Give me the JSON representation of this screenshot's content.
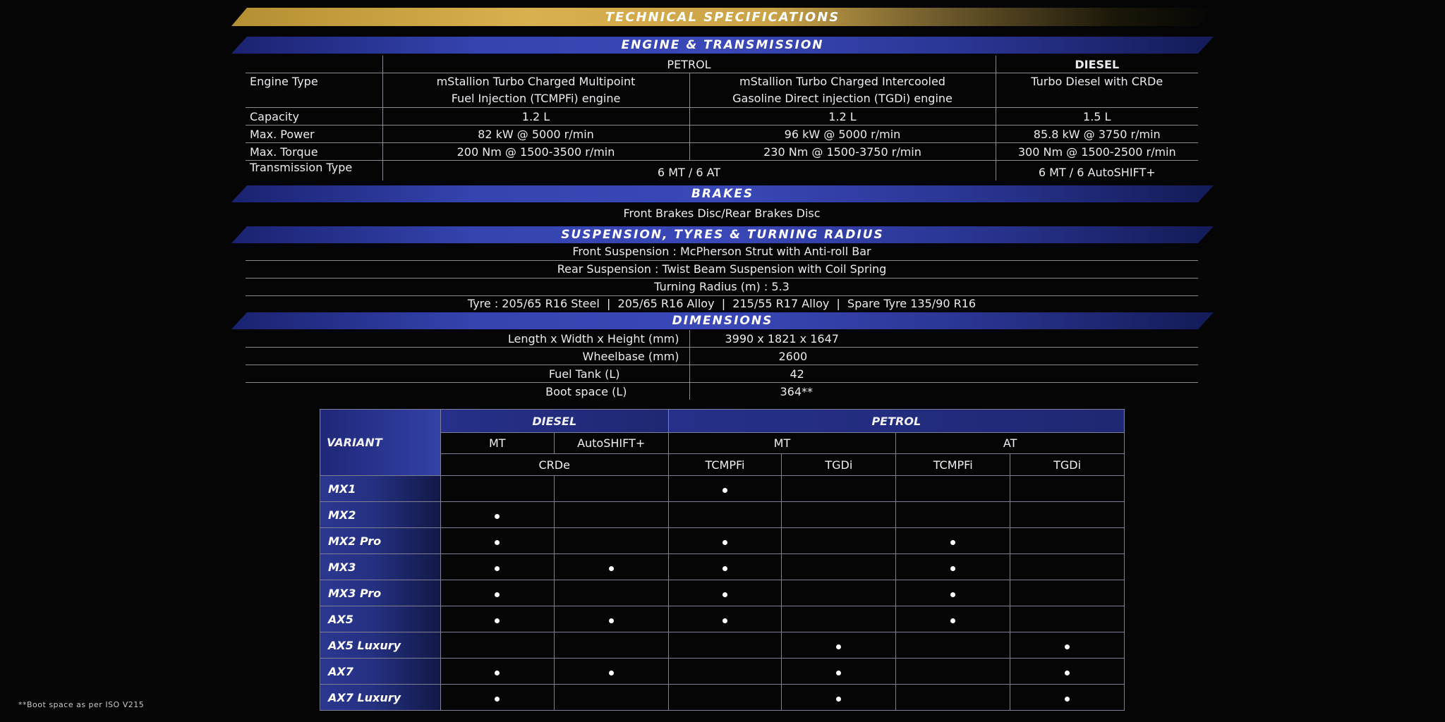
{
  "title": "TECHNICAL SPECIFICATIONS",
  "engine": {
    "heading": "ENGINE & TRANSMISSION",
    "petrol_label": "PETROL",
    "diesel_label": "DIESEL",
    "rows": {
      "engine_type": {
        "label": "Engine Type",
        "p1_line1": "mStallion Turbo Charged Multipoint",
        "p1_line2": "Fuel Injection (TCMPFi) engine",
        "p2_line1": "mStallion Turbo Charged Intercooled",
        "p2_line2": "Gasoline Direct injection (TGDi) engine",
        "d": "Turbo Diesel with CRDe"
      },
      "capacity": {
        "label": "Capacity",
        "p1": "1.2 L",
        "p2": "1.2 L",
        "d": "1.5 L"
      },
      "power": {
        "label": "Max. Power",
        "p1": "82 kW @ 5000 r/min",
        "p2": "96 kW @ 5000 r/min",
        "d": "85.8 kW @ 3750 r/min"
      },
      "torque": {
        "label": "Max. Torque",
        "p1": "200 Nm @ 1500-3500 r/min",
        "p2": "230 Nm @ 1500-3750 r/min",
        "d": "300 Nm @ 1500-2500 r/min"
      },
      "transmission": {
        "label": "Transmission Type",
        "p": "6 MT / 6 AT",
        "d": "6 MT / 6 AutoSHIFT+"
      }
    }
  },
  "brakes": {
    "heading": "BRAKES",
    "text": "Front Brakes Disc/Rear Brakes Disc"
  },
  "suspension": {
    "heading": "SUSPENSION, TYRES & TURNING RADIUS",
    "lines": [
      "Front Suspension : McPherson Strut with Anti-roll Bar",
      "Rear Suspension : Twist Beam Suspension with Coil Spring",
      "Turning Radius (m) : 5.3",
      "Tyre : 205/65 R16 Steel  |  205/65 R16 Alloy  |  215/55 R17 Alloy  |  Spare Tyre 135/90 R16"
    ]
  },
  "dimensions": {
    "heading": "DIMENSIONS",
    "rows": [
      {
        "label": "Length x Width x Height (mm)",
        "value": "3990 x 1821 x 1647"
      },
      {
        "label": "Wheelbase (mm)",
        "value": "2600"
      },
      {
        "label": "Fuel Tank (L)",
        "value": "42"
      },
      {
        "label": "Boot space (L)",
        "value": "364**"
      }
    ]
  },
  "variants": {
    "variant_label": "VARIANT",
    "diesel_label": "DIESEL",
    "petrol_label": "PETROL",
    "mt": "MT",
    "autoshift": "AutoSHIFT+",
    "petrol_mt": "MT",
    "petrol_at": "AT",
    "crde": "CRDe",
    "tcmpfi_mt": "TCMPFi",
    "tgdi_mt": "TGDi",
    "tcmpfi_at": "TCMPFi",
    "tgdi_at": "TGDi",
    "rows": [
      {
        "name": "MX1",
        "marks": [
          0,
          0,
          1,
          0,
          0,
          0
        ]
      },
      {
        "name": "MX2",
        "marks": [
          1,
          0,
          0,
          0,
          0,
          0
        ]
      },
      {
        "name": "MX2 Pro",
        "marks": [
          1,
          0,
          1,
          0,
          1,
          0
        ]
      },
      {
        "name": "MX3",
        "marks": [
          1,
          1,
          1,
          0,
          1,
          0
        ]
      },
      {
        "name": "MX3 Pro",
        "marks": [
          1,
          0,
          1,
          0,
          1,
          0
        ]
      },
      {
        "name": "AX5",
        "marks": [
          1,
          1,
          1,
          0,
          1,
          0
        ]
      },
      {
        "name": "AX5 Luxury",
        "marks": [
          0,
          0,
          0,
          1,
          0,
          1
        ]
      },
      {
        "name": "AX7",
        "marks": [
          1,
          1,
          0,
          1,
          0,
          1
        ]
      },
      {
        "name": "AX7 Luxury",
        "marks": [
          1,
          0,
          0,
          1,
          0,
          1
        ]
      }
    ]
  },
  "footnote": "**Boot space as per ISO V215"
}
